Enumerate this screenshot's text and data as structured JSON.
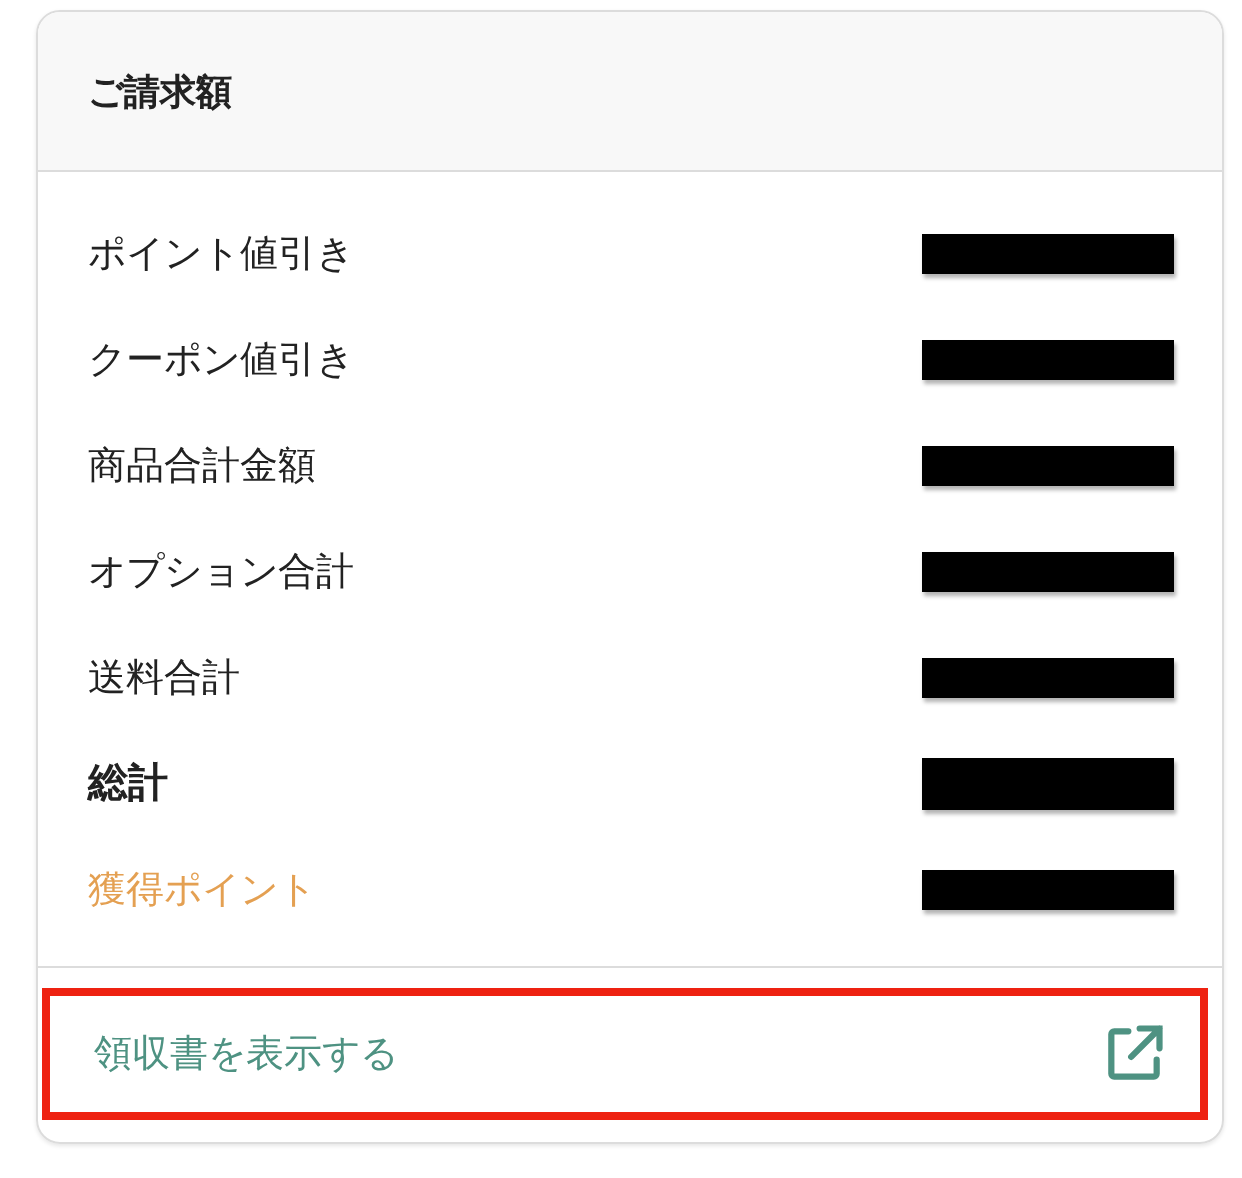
{
  "card": {
    "title": "ご請求額"
  },
  "rows": [
    {
      "label": "ポイント値引き",
      "kind": "normal",
      "redacted": true
    },
    {
      "label": "クーポン値引き",
      "kind": "normal",
      "redacted": true
    },
    {
      "label": "商品合計金額",
      "kind": "normal",
      "redacted": true
    },
    {
      "label": "オプション合計",
      "kind": "normal",
      "redacted": true
    },
    {
      "label": "送料合計",
      "kind": "normal",
      "redacted": true
    },
    {
      "label": "総計",
      "kind": "total",
      "redacted": true
    },
    {
      "label": "獲得ポイント",
      "kind": "points",
      "redacted": true
    }
  ],
  "receipt_link": {
    "label": "領収書を表示する",
    "highlighted": true
  }
}
